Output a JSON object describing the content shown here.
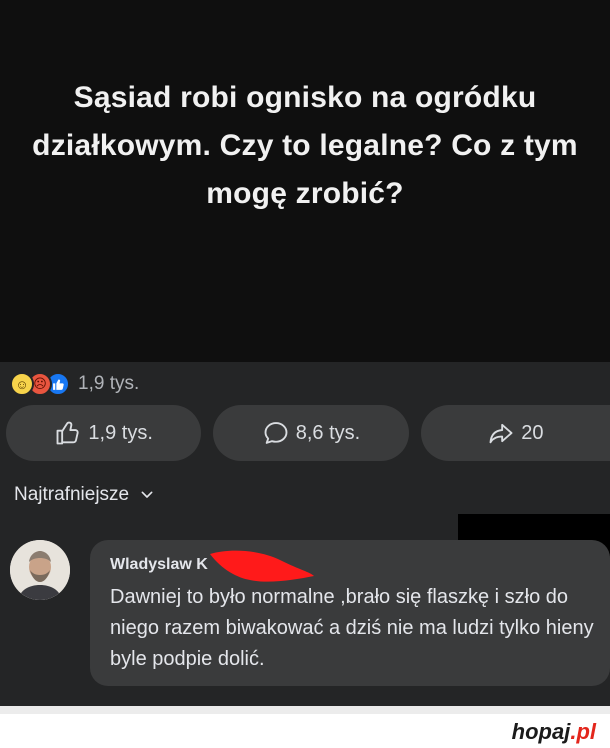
{
  "post": {
    "title": "Sąsiad robi ognisko na ogródku działkowym. Czy to legalne? Co z tym mogę zrobić?"
  },
  "reactions": {
    "emojis": [
      "haha-emoji",
      "angry-emoji",
      "like-emoji"
    ],
    "count": "1,9 tys."
  },
  "actions": {
    "like_count": "1,9 tys.",
    "comment_count": "8,6 tys.",
    "share_count": "20"
  },
  "sort": {
    "label": "Najtrafniejsze"
  },
  "comment": {
    "author": "Wladyslaw K",
    "text": "Dawniej to było normalne ,brało się flaszkę i szło do niego razem biwakować a dziś nie ma ludzi tylko hieny byle podpie dolić."
  },
  "watermark": {
    "site": "hopaj",
    "tld": ".pl"
  },
  "colors": {
    "background": "#242526",
    "header": "#0f0f0f",
    "button": "#3a3b3c",
    "watermark_accent": "#e3261c"
  }
}
